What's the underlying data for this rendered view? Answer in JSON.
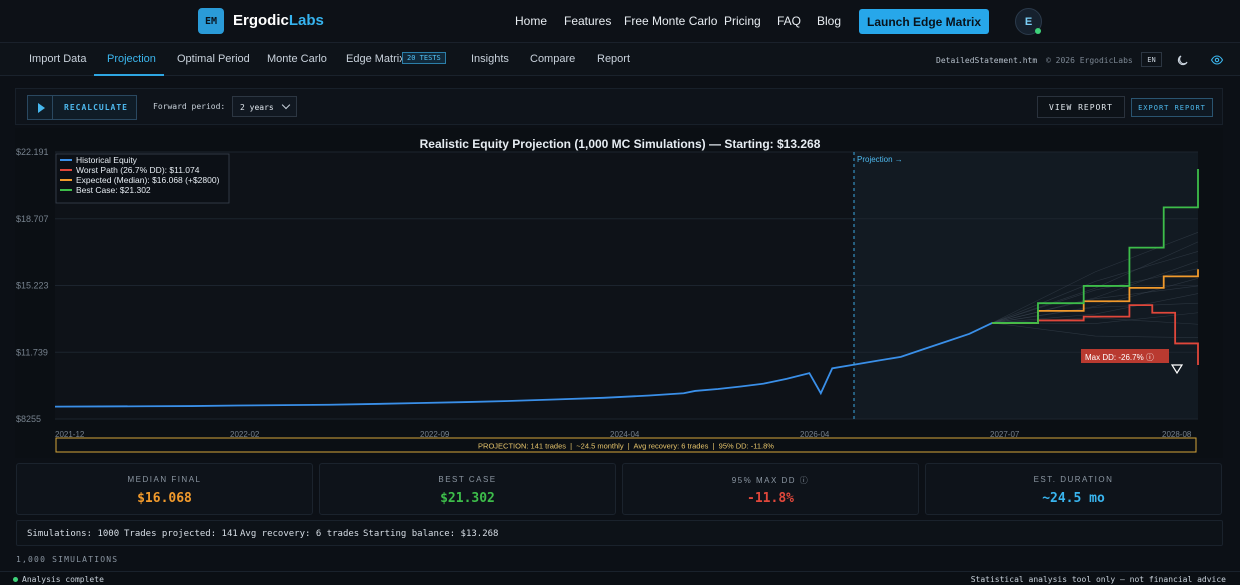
{
  "brand": {
    "logo": "EM",
    "name_a": "Ergodic",
    "name_b": "Labs"
  },
  "nav": {
    "links": [
      "Home",
      "Features",
      "Free Monte Carlo",
      "Pricing",
      "FAQ",
      "Blog"
    ],
    "cta": "Launch Edge Matrix",
    "avatar_letter": "E"
  },
  "tabs": {
    "items": [
      "Import Data",
      "Projection",
      "Optimal Period",
      "Monte Carlo",
      "Edge Matrix",
      "Insights",
      "Compare",
      "Report"
    ],
    "active": "Projection",
    "edge_badge": "20 TESTS",
    "file_name": "DetailedStatement.htm",
    "copyright": "© 2026 ErgodicLabs",
    "lang": "EN",
    "icons": [
      "moon-icon",
      "eye-icon"
    ]
  },
  "toolbar": {
    "recalculate": "RECALCULATE",
    "forward_label": "Forward period:",
    "forward_value": "2 years",
    "view_report": "VIEW REPORT",
    "export_report": "EXPORT REPORT"
  },
  "chart_data": {
    "type": "line",
    "title": "Realistic Equity Projection (1,000 MC Simulations) — Starting: $13.268",
    "y_ticks": [
      "$22.191",
      "$18.707",
      "$15.223",
      "$11.739",
      "$8255"
    ],
    "x_ticks": [
      "2021-12",
      "2022-02",
      "2022-09",
      "2024-04",
      "2026-04",
      "2027-07",
      "2028-08"
    ],
    "ylim": [
      8255,
      22191
    ],
    "projection_label": "Projection →",
    "max_dd_label": "Max DD: -26.7% ⓘ",
    "colors": {
      "historical": "#3a8fe8",
      "worst": "#e0473b",
      "median": "#f19a2c",
      "best": "#3dbd4a"
    },
    "legend": [
      {
        "name": "Historical Equity",
        "color": "#3a8fe8"
      },
      {
        "name": "Worst Path (26.7% DD): $11.074",
        "color": "#e0473b"
      },
      {
        "name": "Expected (Median): $16.068 (+$2800)",
        "color": "#f19a2c"
      },
      {
        "name": "Best Case: $21.302",
        "color": "#3dbd4a"
      }
    ],
    "series": [
      {
        "name": "Historical Equity",
        "x": [
          0,
          0.04,
          0.08,
          0.12,
          0.16,
          0.2,
          0.24,
          0.28,
          0.32,
          0.36,
          0.4,
          0.44,
          0.48,
          0.52,
          0.55,
          0.56,
          0.58,
          0.6,
          0.62,
          0.64,
          0.66,
          0.67,
          0.68,
          0.7,
          0.72,
          0.74,
          0.76,
          0.78,
          0.8,
          0.82
        ],
        "y": [
          8900,
          8910,
          8920,
          8930,
          8960,
          8980,
          9000,
          9040,
          9090,
          9140,
          9200,
          9280,
          9360,
          9480,
          9600,
          9720,
          9820,
          9950,
          10100,
          10350,
          10650,
          9600,
          10900,
          11100,
          11300,
          11500,
          11900,
          12300,
          12700,
          13268
        ]
      },
      {
        "name": "Worst Path",
        "x": [
          0.82,
          0.86,
          0.9,
          0.94,
          0.96,
          0.98,
          1.0
        ],
        "y": [
          13268,
          13400,
          13600,
          14200,
          13800,
          12200,
          11074
        ]
      },
      {
        "name": "Expected (Median)",
        "x": [
          0.82,
          0.86,
          0.9,
          0.94,
          0.97,
          1.0
        ],
        "y": [
          13268,
          13900,
          14400,
          15100,
          15700,
          16068
        ]
      },
      {
        "name": "Best Case",
        "x": [
          0.82,
          0.86,
          0.9,
          0.94,
          0.97,
          1.0
        ],
        "y": [
          13268,
          14300,
          15200,
          17200,
          19300,
          21302
        ]
      }
    ],
    "projection_footer": "PROJECTION: 141 trades  |  ~24.5 monthly  |  Avg recovery: 6 trades  |  95% DD: -11.8%"
  },
  "stats": [
    {
      "label": "MEDIAN FINAL",
      "value": "$16.068",
      "color": "#f19a2c"
    },
    {
      "label": "BEST CASE",
      "value": "$21.302",
      "color": "#3dbd4a"
    },
    {
      "label": "95% MAX DD ⓘ",
      "value": "-11.8%",
      "color": "#e0473b"
    },
    {
      "label": "EST. DURATION",
      "value": "~24.5 mo",
      "color": "#39b5ef"
    }
  ],
  "summary": {
    "simulations": "Simulations: 1000",
    "trades": "Trades projected: 141",
    "recovery": "Avg recovery: 6 trades",
    "balance": "Starting balance: $13.268"
  },
  "sims_caption": "1,000 SIMULATIONS",
  "footer": {
    "status": "Analysis complete",
    "disclaimer": "Statistical analysis tool only — not financial advice"
  }
}
